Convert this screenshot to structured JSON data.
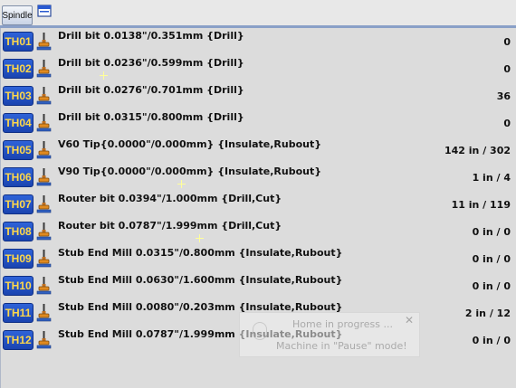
{
  "toolbar": {
    "spindle_label": "Spindle",
    "view_icon": "window-icon"
  },
  "tools": [
    {
      "id": "TH01",
      "desc": "Drill bit 0.0138\"/0.351mm {Drill}",
      "count": "0"
    },
    {
      "id": "TH02",
      "desc": "Drill bit 0.0236\"/0.599mm {Drill}",
      "count": "0"
    },
    {
      "id": "TH03",
      "desc": "Drill bit 0.0276\"/0.701mm {Drill}",
      "count": "36"
    },
    {
      "id": "TH04",
      "desc": "Drill bit 0.0315\"/0.800mm {Drill}",
      "count": "0"
    },
    {
      "id": "TH05",
      "desc": "V60  Tip{0.0000\"/0.000mm} {Insulate,Rubout}",
      "count": "142 in / 302"
    },
    {
      "id": "TH06",
      "desc": "V90  Tip{0.0000\"/0.000mm} {Insulate,Rubout}",
      "count": "1 in / 4"
    },
    {
      "id": "TH07",
      "desc": "Router bit 0.0394\"/1.000mm {Drill,Cut}",
      "count": "11 in / 119"
    },
    {
      "id": "TH08",
      "desc": "Router bit 0.0787\"/1.999mm {Drill,Cut}",
      "count": "0 in / 0"
    },
    {
      "id": "TH09",
      "desc": "Stub End Mill 0.0315\"/0.800mm {Insulate,Rubout}",
      "count": "0 in / 0"
    },
    {
      "id": "TH10",
      "desc": "Stub End Mill 0.0630\"/1.600mm {Insulate,Rubout}",
      "count": "0 in / 0"
    },
    {
      "id": "TH11",
      "desc": "Stub End Mill 0.0080\"/0.203mm {Insulate,Rubout}",
      "count": "2 in / 12"
    },
    {
      "id": "TH12",
      "desc": "Stub End Mill 0.0787\"/1.999mm {Insulate,Rubout}",
      "count": "0 in / 0"
    }
  ],
  "tool_icon": "spindle-tool-icon",
  "popup": {
    "line1": "Home in progress ...",
    "line2": "Machine in \"Pause\" mode!",
    "close": "✕"
  },
  "colors": {
    "badge_bg": "#1f4fc4",
    "badge_text": "#ffd84a",
    "list_bg": "#dcdcdc"
  }
}
